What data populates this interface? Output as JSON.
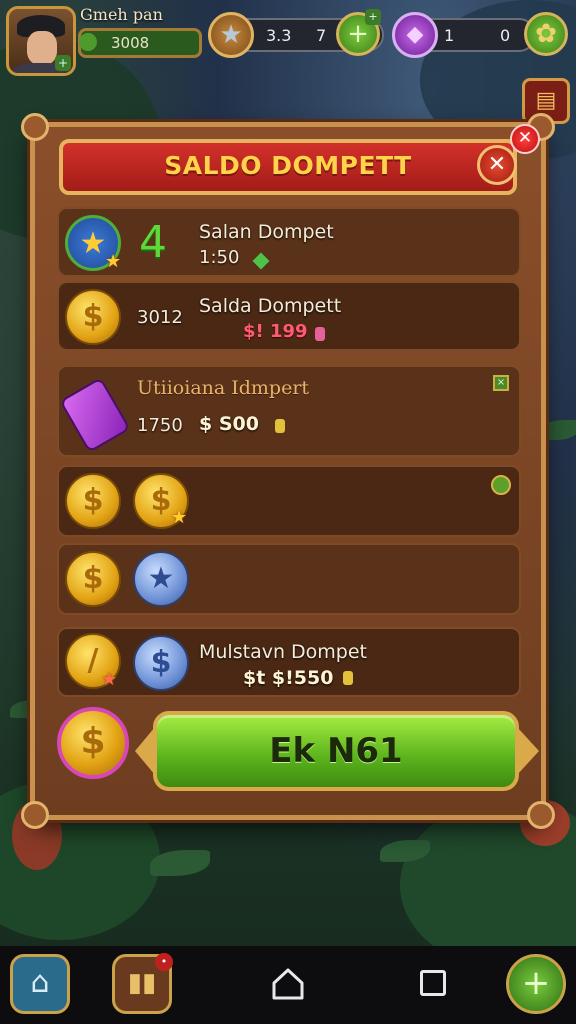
{
  "hud": {
    "player_name": "Gmeh pan",
    "xp_value": "3008",
    "star_count_a": "3.3",
    "star_count_b": "7",
    "gem_count_a": "1",
    "gem_count_b": "0"
  },
  "dialog": {
    "title": "SALDO DOMPETT",
    "close_label": "✕",
    "rows": [
      {
        "title": "Salan Dompet",
        "amount": "1:50"
      },
      {
        "number": "3012",
        "title": "Salda Dompett",
        "amount": "$! 199"
      },
      {
        "title": "Utiioiana Idmpert",
        "number": "1750",
        "amount": "$ S00"
      },
      {
        "title": "Mulstavn Dompet",
        "amount": "$t $!550"
      }
    ],
    "action_button": "Ek N61"
  },
  "icons": {
    "star": "star-icon",
    "gem": "gem-icon",
    "coin": "coin-icon",
    "home": "home-icon",
    "stats": "stats-icon",
    "plus": "plus-icon"
  },
  "colors": {
    "banner_red": "#c42a22",
    "title_gold": "#ffd34a",
    "panel_brown": "#7a4526",
    "action_green": "#5ab21c",
    "price_pink": "#ff5a76"
  }
}
